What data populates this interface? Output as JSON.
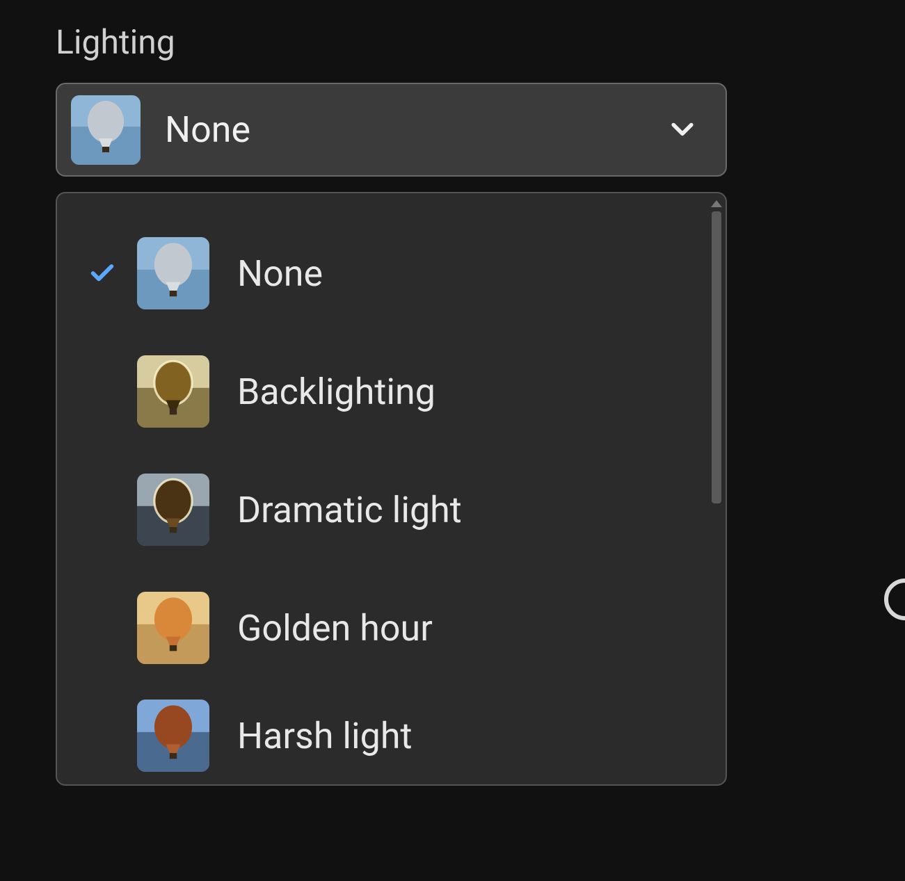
{
  "lighting": {
    "label": "Lighting",
    "selected": {
      "label": "None",
      "thumb": "none"
    },
    "options": [
      {
        "label": "None",
        "thumb": "none",
        "selected": true
      },
      {
        "label": "Backlighting",
        "thumb": "backlighting",
        "selected": false
      },
      {
        "label": "Dramatic light",
        "thumb": "dramatic",
        "selected": false
      },
      {
        "label": "Golden hour",
        "thumb": "golden",
        "selected": false
      },
      {
        "label": "Harsh light",
        "thumb": "harsh",
        "selected": false
      }
    ]
  }
}
